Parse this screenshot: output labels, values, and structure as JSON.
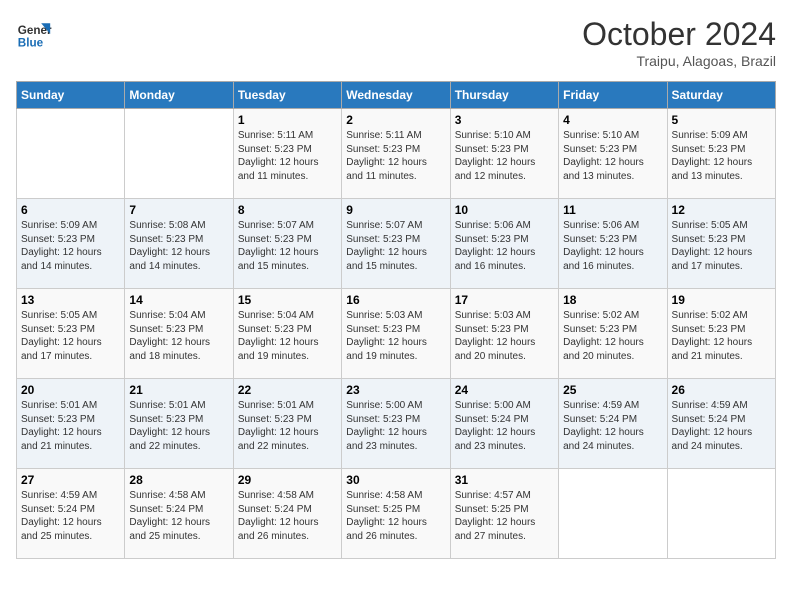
{
  "header": {
    "logo_line1": "General",
    "logo_line2": "Blue",
    "month": "October 2024",
    "location": "Traipu, Alagoas, Brazil"
  },
  "weekdays": [
    "Sunday",
    "Monday",
    "Tuesday",
    "Wednesday",
    "Thursday",
    "Friday",
    "Saturday"
  ],
  "weeks": [
    [
      {
        "day": "",
        "info": ""
      },
      {
        "day": "",
        "info": ""
      },
      {
        "day": "1",
        "info": "Sunrise: 5:11 AM\nSunset: 5:23 PM\nDaylight: 12 hours\nand 11 minutes."
      },
      {
        "day": "2",
        "info": "Sunrise: 5:11 AM\nSunset: 5:23 PM\nDaylight: 12 hours\nand 11 minutes."
      },
      {
        "day": "3",
        "info": "Sunrise: 5:10 AM\nSunset: 5:23 PM\nDaylight: 12 hours\nand 12 minutes."
      },
      {
        "day": "4",
        "info": "Sunrise: 5:10 AM\nSunset: 5:23 PM\nDaylight: 12 hours\nand 13 minutes."
      },
      {
        "day": "5",
        "info": "Sunrise: 5:09 AM\nSunset: 5:23 PM\nDaylight: 12 hours\nand 13 minutes."
      }
    ],
    [
      {
        "day": "6",
        "info": "Sunrise: 5:09 AM\nSunset: 5:23 PM\nDaylight: 12 hours\nand 14 minutes."
      },
      {
        "day": "7",
        "info": "Sunrise: 5:08 AM\nSunset: 5:23 PM\nDaylight: 12 hours\nand 14 minutes."
      },
      {
        "day": "8",
        "info": "Sunrise: 5:07 AM\nSunset: 5:23 PM\nDaylight: 12 hours\nand 15 minutes."
      },
      {
        "day": "9",
        "info": "Sunrise: 5:07 AM\nSunset: 5:23 PM\nDaylight: 12 hours\nand 15 minutes."
      },
      {
        "day": "10",
        "info": "Sunrise: 5:06 AM\nSunset: 5:23 PM\nDaylight: 12 hours\nand 16 minutes."
      },
      {
        "day": "11",
        "info": "Sunrise: 5:06 AM\nSunset: 5:23 PM\nDaylight: 12 hours\nand 16 minutes."
      },
      {
        "day": "12",
        "info": "Sunrise: 5:05 AM\nSunset: 5:23 PM\nDaylight: 12 hours\nand 17 minutes."
      }
    ],
    [
      {
        "day": "13",
        "info": "Sunrise: 5:05 AM\nSunset: 5:23 PM\nDaylight: 12 hours\nand 17 minutes."
      },
      {
        "day": "14",
        "info": "Sunrise: 5:04 AM\nSunset: 5:23 PM\nDaylight: 12 hours\nand 18 minutes."
      },
      {
        "day": "15",
        "info": "Sunrise: 5:04 AM\nSunset: 5:23 PM\nDaylight: 12 hours\nand 19 minutes."
      },
      {
        "day": "16",
        "info": "Sunrise: 5:03 AM\nSunset: 5:23 PM\nDaylight: 12 hours\nand 19 minutes."
      },
      {
        "day": "17",
        "info": "Sunrise: 5:03 AM\nSunset: 5:23 PM\nDaylight: 12 hours\nand 20 minutes."
      },
      {
        "day": "18",
        "info": "Sunrise: 5:02 AM\nSunset: 5:23 PM\nDaylight: 12 hours\nand 20 minutes."
      },
      {
        "day": "19",
        "info": "Sunrise: 5:02 AM\nSunset: 5:23 PM\nDaylight: 12 hours\nand 21 minutes."
      }
    ],
    [
      {
        "day": "20",
        "info": "Sunrise: 5:01 AM\nSunset: 5:23 PM\nDaylight: 12 hours\nand 21 minutes."
      },
      {
        "day": "21",
        "info": "Sunrise: 5:01 AM\nSunset: 5:23 PM\nDaylight: 12 hours\nand 22 minutes."
      },
      {
        "day": "22",
        "info": "Sunrise: 5:01 AM\nSunset: 5:23 PM\nDaylight: 12 hours\nand 22 minutes."
      },
      {
        "day": "23",
        "info": "Sunrise: 5:00 AM\nSunset: 5:23 PM\nDaylight: 12 hours\nand 23 minutes."
      },
      {
        "day": "24",
        "info": "Sunrise: 5:00 AM\nSunset: 5:24 PM\nDaylight: 12 hours\nand 23 minutes."
      },
      {
        "day": "25",
        "info": "Sunrise: 4:59 AM\nSunset: 5:24 PM\nDaylight: 12 hours\nand 24 minutes."
      },
      {
        "day": "26",
        "info": "Sunrise: 4:59 AM\nSunset: 5:24 PM\nDaylight: 12 hours\nand 24 minutes."
      }
    ],
    [
      {
        "day": "27",
        "info": "Sunrise: 4:59 AM\nSunset: 5:24 PM\nDaylight: 12 hours\nand 25 minutes."
      },
      {
        "day": "28",
        "info": "Sunrise: 4:58 AM\nSunset: 5:24 PM\nDaylight: 12 hours\nand 25 minutes."
      },
      {
        "day": "29",
        "info": "Sunrise: 4:58 AM\nSunset: 5:24 PM\nDaylight: 12 hours\nand 26 minutes."
      },
      {
        "day": "30",
        "info": "Sunrise: 4:58 AM\nSunset: 5:25 PM\nDaylight: 12 hours\nand 26 minutes."
      },
      {
        "day": "31",
        "info": "Sunrise: 4:57 AM\nSunset: 5:25 PM\nDaylight: 12 hours\nand 27 minutes."
      },
      {
        "day": "",
        "info": ""
      },
      {
        "day": "",
        "info": ""
      }
    ]
  ]
}
